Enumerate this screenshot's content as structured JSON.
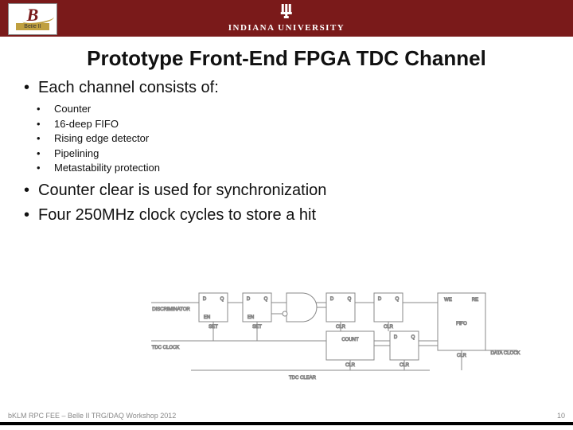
{
  "header": {
    "belle_logo_caption": "Belle II",
    "institution": "INDIANA UNIVERSITY"
  },
  "title": "Prototype Front-End FPGA TDC Channel",
  "bullets_top": [
    "Each channel consists of:"
  ],
  "sub_bullets": [
    "Counter",
    "16-deep FIFO",
    "Rising edge detector",
    "Pipelining",
    "Metastability protection"
  ],
  "bullets_bottom": [
    "Counter clear is used for synchronization",
    "Four 250MHz clock cycles to store a hit"
  ],
  "diagram": {
    "labels": {
      "discriminator": "DISCRIMINATOR",
      "tdc_clock": "TDC CLOCK",
      "tdc_clear": "TDC CLEAR",
      "data_clock": "DATA CLOCK",
      "count": "COUNT",
      "we": "WE",
      "re": "RE",
      "fifo": "FIFO",
      "clr": "CLR",
      "set": "SET",
      "en": "EN",
      "d": "D",
      "q": "Q"
    }
  },
  "footer": {
    "left": "bKLM RPC FEE – Belle II TRG/DAQ Workshop 2012",
    "right": "10"
  }
}
